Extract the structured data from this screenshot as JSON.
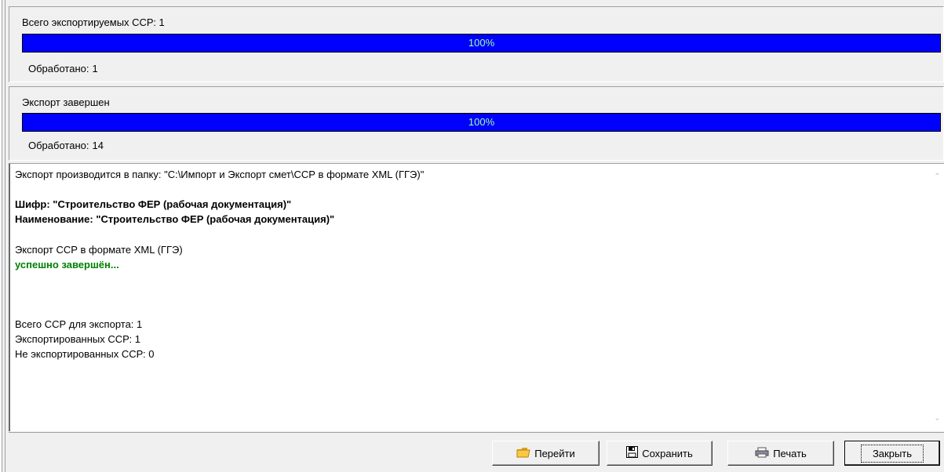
{
  "panel1": {
    "title": "Всего экспортируемых ССР: 1",
    "progress_text": "100%",
    "progress_value": 1.0,
    "processed_label": "Обработано:",
    "processed_value": "1"
  },
  "panel2": {
    "title": "Экспорт завершен",
    "progress_text": "100%",
    "progress_value": 1.0,
    "processed_label": "Обработано:",
    "processed_value": "14"
  },
  "log": {
    "line1": "Экспорт производится в папку: \"C:\\Импорт и Экспорт смет\\ССР в формате XML (ГГЭ)\"",
    "cipher": "Шифр: \"Строительство ФЕР (рабочая документация)\"",
    "name": "Наименование: \"Строительство ФЕР (рабочая документация)\"",
    "export_line": "Экспорт ССР в формате XML (ГГЭ)",
    "success": "успешно завершён...",
    "total": "Всего ССР для экспорта: 1",
    "exported": "Экспортированных ССР: 1",
    "not_exported": "Не экспортированных ССР: 0"
  },
  "buttons": {
    "goto": "Перейти",
    "save": "Сохранить",
    "print": "Печать",
    "close": "Закрыть"
  },
  "colors": {
    "progress": "#0000ff",
    "progress_text": "#a0ffa0",
    "success": "#008000"
  },
  "icons": {
    "goto": "folder-icon",
    "save": "floppy-disk-icon",
    "print": "printer-icon"
  }
}
